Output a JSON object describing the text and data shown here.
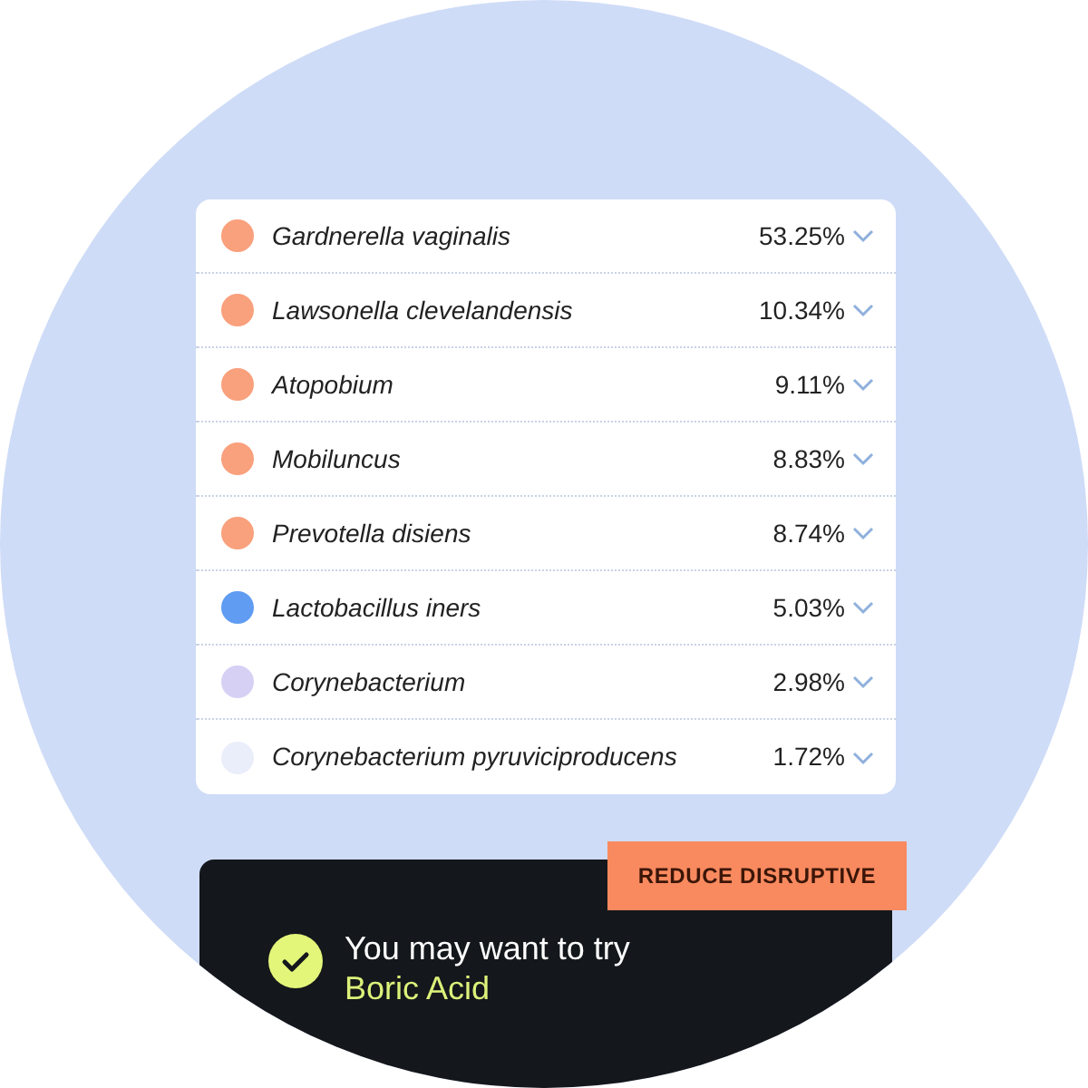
{
  "species": [
    {
      "name": "Gardnerella vaginalis",
      "percent": "53.25%",
      "color": "#f9a07c"
    },
    {
      "name": "Lawsonella clevelandensis",
      "percent": "10.34%",
      "color": "#f9a07c"
    },
    {
      "name": "Atopobium",
      "percent": "9.11%",
      "color": "#f9a07c"
    },
    {
      "name": "Mobiluncus",
      "percent": "8.83%",
      "color": "#f9a07c"
    },
    {
      "name": "Prevotella disiens",
      "percent": "8.74%",
      "color": "#f9a07c"
    },
    {
      "name": "Lactobacillus iners",
      "percent": "5.03%",
      "color": "#5f9cf2"
    },
    {
      "name": "Corynebacterium",
      "percent": "2.98%",
      "color": "#d6d0f5"
    },
    {
      "name": "Corynebacterium pyruviciproducens",
      "percent": "1.72%",
      "color": "#eaeefa"
    }
  ],
  "recommendation": {
    "badge": "REDUCE DISRUPTIVE",
    "lead": "You may want to try",
    "product": "Boric Acid"
  }
}
